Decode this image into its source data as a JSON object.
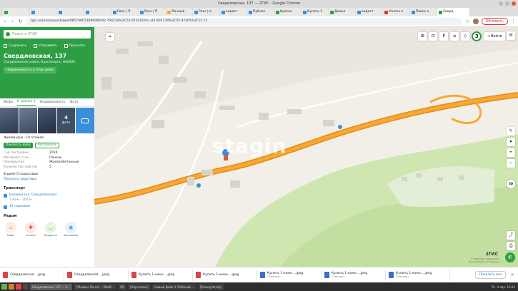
{
  "window": {
    "title": "Свердловская, 137 — 2ГИС - Google Chrome"
  },
  "tabs": [
    {
      "label": "",
      "icon": "green"
    },
    {
      "label": "",
      "icon": "blue"
    },
    {
      "label": "",
      "icon": "blue"
    },
    {
      "label": "",
      "icon": "blue"
    },
    {
      "label": "Рекс | Л",
      "icon": "blue"
    },
    {
      "label": "Рекс | П",
      "icon": "blue"
    },
    {
      "label": "Личный",
      "icon": "yellow"
    },
    {
      "label": "Рекс | а",
      "icon": "blue"
    },
    {
      "label": "кадаст",
      "icon": "blue"
    },
    {
      "label": "Публич",
      "icon": "blue"
    },
    {
      "label": "Красно",
      "icon": "green"
    },
    {
      "label": "Купить 1",
      "icon": "blue"
    },
    {
      "label": "Домкл",
      "icon": "green"
    },
    {
      "label": "кадаст",
      "icon": "blue"
    },
    {
      "label": "Узнать к",
      "icon": "red"
    },
    {
      "label": "Поиск о",
      "icon": "blue"
    },
    {
      "label": "Сверд",
      "icon": "green",
      "active": true
    }
  ],
  "address_bar": {
    "url": "2gis.ru/krasnoyarsk/geo/985748073696096/92.794234%2C55.973202?m=92.802178%2C55.97405%2F15.71"
  },
  "update_button": "Обновить",
  "sidebar": {
    "search_placeholder": "Поиск в 2ГИС",
    "actions": [
      "Сохранить",
      "Отправить",
      "Проехать"
    ],
    "address_title": "Свердловская, 137",
    "address_sub": "Свердловский район, Красноярск, 660006",
    "realty_button": "Недвижимость в этом доме",
    "tabs": [
      "Инфо",
      "В здании",
      "Недвижимость",
      "Фото"
    ],
    "tab_counts": [
      "",
      "1",
      "",
      ""
    ],
    "photo_count": "4",
    "photo_word": "фото",
    "building_type": "Жилой дом · 10 этажей",
    "show_entrance": "Показать вход",
    "suggest": "Рассказать",
    "props": [
      {
        "k": "Год постройки",
        "v": "2010"
      },
      {
        "k": "Материал стен",
        "v": "Панель"
      },
      {
        "k": "Перекрытия",
        "v": "Железобетонные"
      },
      {
        "k": "Количество лифтов",
        "v": "5"
      }
    ],
    "entrances": "В доме 5 подъездов",
    "show_apartments": "Показать квартиры",
    "transport_title": "Транспорт",
    "stop_name": "Базаиха (ул. Свердловская)",
    "stop_sub": "1 мин · 100 м",
    "parking": "12 парковок",
    "nearby_title": "Рядом",
    "nearby": [
      "Кафе",
      "Аптеки",
      "Продукты",
      "Автомойки"
    ]
  },
  "map": {
    "watermark": "stagin",
    "login": "Войти",
    "layers_count": "3",
    "zoom_badge": "3D",
    "brand": "2ГИС",
    "copyright": "© 2026 ООО «ДубльГИС»\nЛицензионное соглашение"
  },
  "downloads": [
    {
      "name": "Свердловская....jpeg",
      "sub": "",
      "type": "red"
    },
    {
      "name": "Свердловская....jpeg",
      "sub": "",
      "type": "red"
    },
    {
      "name": "Купить 1-комн....jpeg",
      "sub": "",
      "type": "red"
    },
    {
      "name": "Купить 1-комн....jpeg",
      "sub": "",
      "type": "red"
    },
    {
      "name": "Купить 1-комн....jpeg",
      "sub": "Отменено",
      "type": "blue"
    },
    {
      "name": "Купить 1-комн....jpeg",
      "sub": "Отменено",
      "type": "blue"
    },
    {
      "name": "Купить 1-комн....jpeg",
      "sub": "Отменено",
      "type": "blue"
    }
  ],
  "show_all": "Показать все",
  "taskbar": {
    "windows": [
      "Свердловская, 137 — 2...",
      "[*Яндекс Почта — Mozill...",
      "[Я]",
      "[Апргалека]",
      "[новый файл 1 (Рабочий ...",
      "[Калькулятор]"
    ],
    "tray": "Пт, 4 апр, 13:24"
  }
}
